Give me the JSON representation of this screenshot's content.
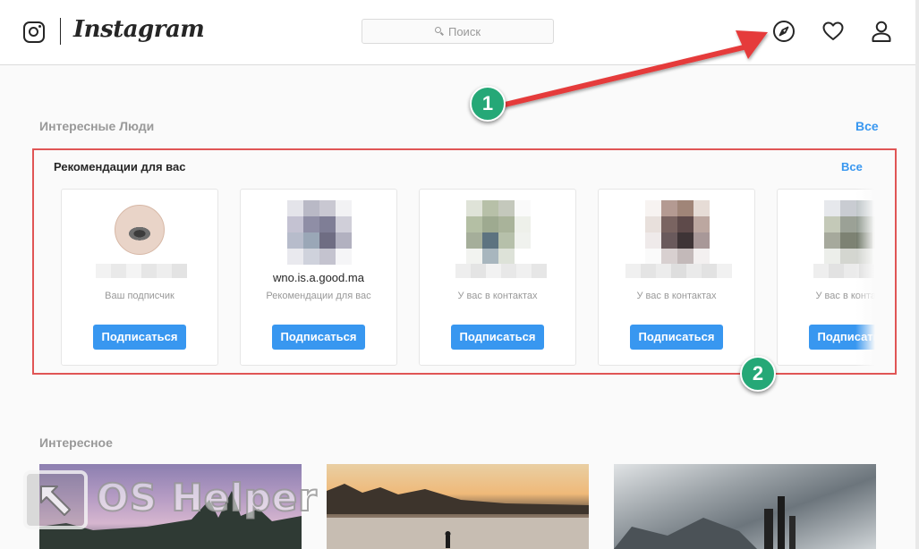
{
  "header": {
    "logo_icon": "instagram-glyph-icon",
    "wordmark": "Instagram",
    "search": {
      "placeholder": "Поиск",
      "icon": "search-icon"
    },
    "nav_icons": [
      "compass-icon",
      "heart-icon",
      "person-icon"
    ]
  },
  "people": {
    "title": "Интересные Люди",
    "all_link": "Все"
  },
  "recommendations": {
    "title": "Рекомендации для вас",
    "all_link": "Все",
    "cards": [
      {
        "username": "",
        "subtitle": "Ваш подписчик",
        "button": "Подписаться"
      },
      {
        "username": "wno.is.a.good.ma",
        "subtitle": "Рекомендации для вас",
        "button": "Подписаться"
      },
      {
        "username": "",
        "subtitle": "У вас в контактах",
        "button": "Подписаться"
      },
      {
        "username": "",
        "subtitle": "У вас в контактах",
        "button": "Подписаться"
      },
      {
        "username": "",
        "subtitle": "У вас в контактах",
        "button": "Подписаться"
      }
    ]
  },
  "interesting": {
    "title": "Интересное"
  },
  "annotations": {
    "badge_1": "1",
    "badge_2": "2",
    "highlight_color": "#e05555",
    "badge_color": "#25a877"
  },
  "watermark": {
    "text": "OS Helper",
    "icon": "cursor-arrow-icon"
  },
  "colors": {
    "accent": "#3897f0",
    "muted_text": "#999999",
    "background": "#fafafa"
  }
}
